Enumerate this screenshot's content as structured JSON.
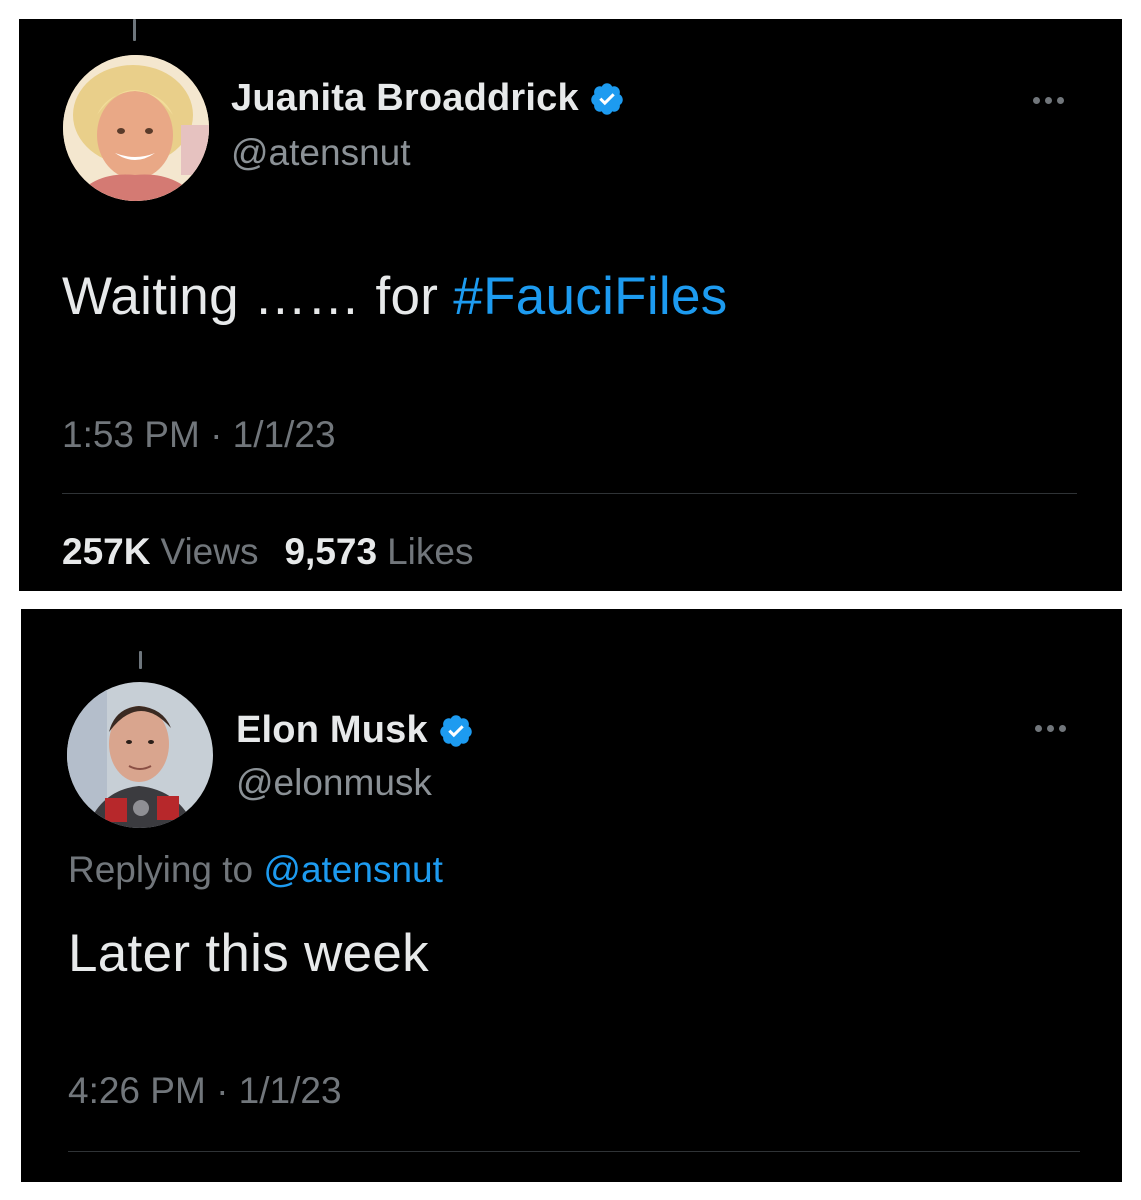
{
  "tweets": [
    {
      "author": {
        "display_name": "Juanita Broaddrick",
        "handle": "@atensnut",
        "verified": true
      },
      "text_plain": "Waiting …… for ",
      "hashtag": "#FauciFiles",
      "timestamp": "1:53 PM · 1/1/23",
      "stats": {
        "views_count": "257K",
        "views_label": "Views",
        "likes_count": "9,573",
        "likes_label": "Likes"
      }
    },
    {
      "author": {
        "display_name": "Elon Musk",
        "handle": "@elonmusk",
        "verified": true
      },
      "replying_to_label": "Replying to",
      "replying_to_handle": "@atensnut",
      "text": "Later this week",
      "timestamp": "4:26 PM · 1/1/23"
    }
  ],
  "colors": {
    "background": "#000000",
    "page_background": "#ffffff",
    "primary_text": "#e7e9ea",
    "secondary_text": "#71767b",
    "accent": "#1d9bf0",
    "divider": "#2f3336"
  },
  "icons": {
    "verified": "verified-badge-icon",
    "more": "more-horizontal-icon"
  }
}
